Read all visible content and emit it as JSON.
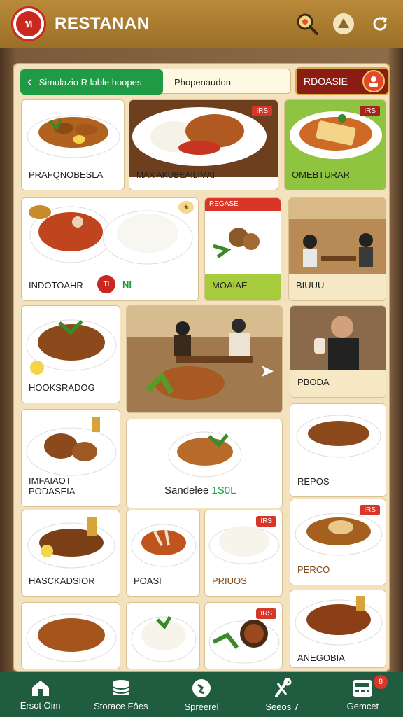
{
  "app": {
    "title": "RESTANAN",
    "logo_text": "ท"
  },
  "filters": {
    "back_label": "Simulazio R ləble hoopes",
    "secondary_label": "Phopenaudon",
    "promo_label": "RDOASIE"
  },
  "cards": [
    {
      "label": "PRAFQNOBESLA"
    },
    {
      "label": "MAX AKUBEAILIMAI",
      "tag": "IRS"
    },
    {
      "label": "OMEBTURAR",
      "tag": "IRS"
    },
    {
      "label": "INDOTOAHR",
      "extra": "NI",
      "tag": "TI"
    },
    {
      "label": "MOAIAE",
      "tag": "REGASE"
    },
    {
      "label": "BIUUU"
    },
    {
      "label": "HOOKSRADOG"
    },
    {
      "label": "PBODA"
    },
    {
      "label": "IMFAIAOT PODASEIA"
    },
    {
      "label": "Sandelee",
      "extra": "1S0L"
    },
    {
      "label": "REPOS"
    },
    {
      "label": "HASCKADSIOR"
    },
    {
      "label": "POASI"
    },
    {
      "label": "PRIUOS",
      "tag": "IRS"
    },
    {
      "label": "PERCO",
      "tag": "IRS"
    },
    {
      "label": ""
    },
    {
      "label": ""
    },
    {
      "label": "",
      "tag": "IRS"
    },
    {
      "label": "ANEGOBIA"
    }
  ],
  "nav": [
    {
      "label": "Ersot Oim",
      "icon": "home-icon"
    },
    {
      "label": "Storace Fôes",
      "icon": "database-icon"
    },
    {
      "label": "Spreerel",
      "icon": "globe-icon"
    },
    {
      "label": "Seeos 7",
      "icon": "tools-icon"
    },
    {
      "label": "Gemcet",
      "icon": "calculator-icon",
      "badge": "8"
    }
  ],
  "colors": {
    "header": "#a87a2e",
    "panel": "#f3e2bd",
    "nav": "#1f5d3e",
    "accent_red": "#d73628",
    "accent_green": "#1e9b44"
  }
}
